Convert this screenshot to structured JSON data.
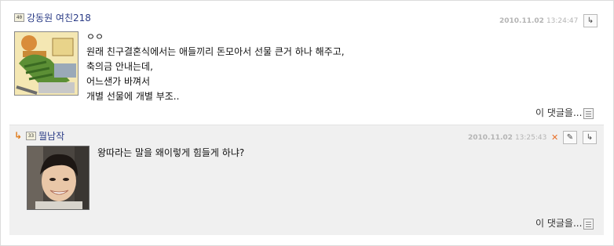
{
  "comments": [
    {
      "level": "40",
      "author": "강동원 여친218",
      "date": "2010.11.02",
      "time": "13:24:47",
      "lines": [
        "ㅇㅇ",
        "원래 친구결혼식에서는 애들끼리 돈모아서 선물 큰거 하나 해주고,",
        "축의금 안내는데,",
        "어느샌가 바껴서",
        "개별 선물에 개별 부조.."
      ],
      "reply_link": "이 댓글을..."
    },
    {
      "level": "33",
      "author": "뭘남작",
      "date": "2010.11.02",
      "time": "13:25:43",
      "lines": [
        "왕따라는 말을 왜이렇게 힘들게 하냐?"
      ],
      "reply_link": "이 댓글을..."
    }
  ],
  "colors": {
    "author": "#2a3b86",
    "meta": "#b4b4b4",
    "delete": "#e8702a",
    "reply_bg": "#f0f0f0"
  },
  "icons": {
    "reply_arrow": "reply-arrow-icon",
    "delete": "delete-icon",
    "edit": "edit-icon",
    "reply_button": "reply-button-icon"
  }
}
